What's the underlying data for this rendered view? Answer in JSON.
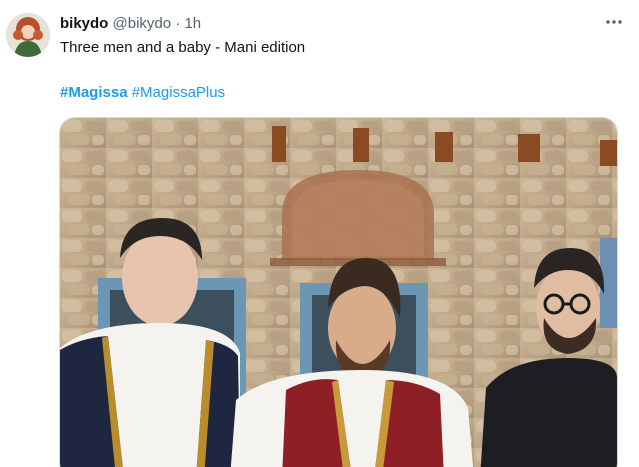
{
  "author": {
    "display_name": "bikydo",
    "handle": "@bikydo",
    "separator": "·",
    "time": "1h",
    "avatar_icon": "avatar-illustration-icon"
  },
  "more_icon": "more-horizontal-icon",
  "tweet": {
    "text": "Three men and a baby - Mani edition",
    "hashtags": [
      "#Magissa",
      "#MagissaPlus"
    ]
  },
  "colors": {
    "link": "#1d9bf0",
    "secondary_text": "#536471",
    "primary_text": "#0f1419"
  }
}
